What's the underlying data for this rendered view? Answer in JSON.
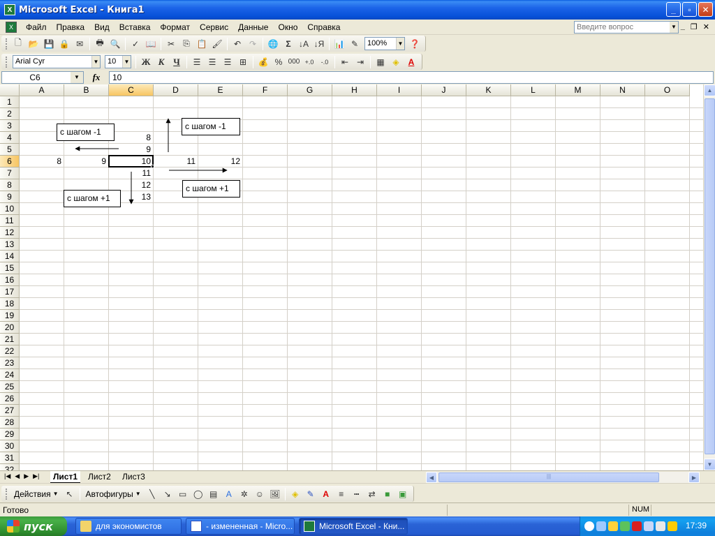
{
  "window": {
    "title": "Microsoft Excel - Книга1",
    "minimize": "_",
    "maximize": "▫",
    "close": "✕"
  },
  "menu": {
    "items": [
      "Файл",
      "Правка",
      "Вид",
      "Вставка",
      "Формат",
      "Сервис",
      "Данные",
      "Окно",
      "Справка"
    ],
    "help_placeholder": "Введите вопрос"
  },
  "standard_toolbar": {
    "zoom": "100%"
  },
  "formatting_toolbar": {
    "font": "Arial Cyr",
    "size": "10",
    "bold": "Ж",
    "italic": "К",
    "underline": "Ч",
    "percent": "%",
    "thousands": "000"
  },
  "formula_bar": {
    "name_box": "C6",
    "fx": "fx",
    "formula": "10"
  },
  "grid": {
    "columns": [
      "A",
      "B",
      "C",
      "D",
      "E",
      "F",
      "G",
      "H",
      "I",
      "J",
      "K",
      "L",
      "M",
      "N",
      "O"
    ],
    "rows": [
      "1",
      "2",
      "3",
      "4",
      "5",
      "6",
      "7",
      "8",
      "9",
      "10",
      "11",
      "12",
      "13",
      "14",
      "15",
      "16",
      "17",
      "18",
      "19",
      "20",
      "21",
      "22",
      "23",
      "24",
      "25",
      "26",
      "27",
      "28",
      "29",
      "30",
      "31",
      "32"
    ],
    "selected_column": "C",
    "selected_row": "6",
    "cells": {
      "C4": "8",
      "C5": "9",
      "A6": "8",
      "B6": "9",
      "C6": "10",
      "D6": "11",
      "E6": "12",
      "C7": "11",
      "C8": "12",
      "C9": "13"
    },
    "notes": {
      "left_up": "с шагом -1",
      "right_up": "с шагом -1",
      "right_down": "с шагом +1",
      "left_down": "с шагом +1"
    }
  },
  "sheets": [
    "Лист1",
    "Лист2",
    "Лист3"
  ],
  "active_sheet": "Лист1",
  "drawing_toolbar": {
    "actions": "Действия",
    "autoshapes": "Автофигуры"
  },
  "status": {
    "text": "Готово",
    "num": "NUM"
  },
  "taskbar": {
    "start": "пуск",
    "tasks": [
      "для экономистов",
      "- измененная - Micro...",
      "Microsoft Excel - Кни..."
    ],
    "clock": "17:39"
  },
  "colors": {
    "titlebar": "#0a5ce0",
    "selected_header": "#f7c562",
    "start_button": "#3c9a3c",
    "taskbar": "#245bd0"
  }
}
